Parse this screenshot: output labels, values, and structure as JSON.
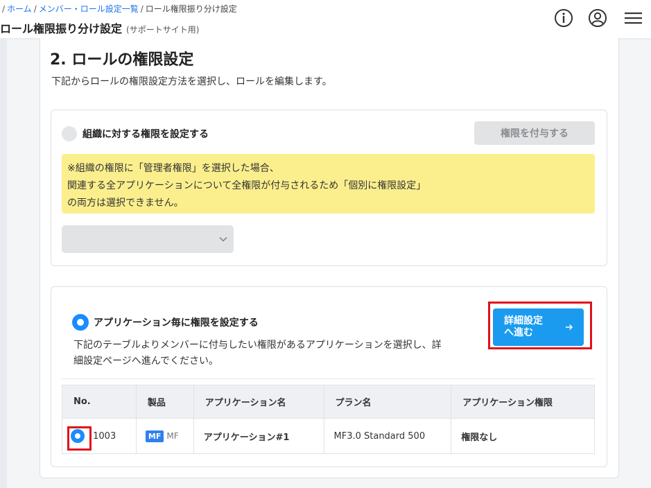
{
  "header": {
    "breadcrumb": {
      "lead_sep": "/",
      "home": "ホーム",
      "sep": "/",
      "members": "メンバー・ロール設定一覧",
      "current": "ロール権限振り分け設定"
    },
    "title": "ロール権限振り分け設定",
    "subtitle": "(サポートサイト用)",
    "icons": [
      "info-icon",
      "user-icon",
      "menu-icon"
    ]
  },
  "section": {
    "title": "2. ロールの権限設定",
    "description": "下記からロールの権限設定方法を選択し、ロールを編集します。"
  },
  "org_option": {
    "label": "組織に対する権限を設定する",
    "selected": false,
    "grant_button": "権限を付与する",
    "note_lines": [
      "※組織の権限に「管理者権限」を選択した場合、",
      "関連する全アプリケーションについて全権限が付与されるため「個別に権限設定」",
      "の両方は選択できません。"
    ],
    "select_value": ""
  },
  "app_option": {
    "label": "アプリケーション毎に権限を設定する",
    "selected": true,
    "description_lines": [
      "下記のテーブルよりメンバーに付与したい権限があるアプリケーションを選択し、詳",
      "細設定ページへ進んでください。"
    ],
    "detail_button_line1": "詳細設定",
    "detail_button_line2": "へ進む",
    "table": {
      "headers": [
        "No.",
        "製品",
        "アプリケーション名",
        "プラン名",
        "アプリケーション権限"
      ],
      "rows": [
        {
          "no": "1003",
          "product_badge": "MF",
          "product_name": "MF",
          "app_name": "アプリケーション#1",
          "plan": "MF3.0 Standard 500",
          "permission": "権限なし",
          "selected": true
        }
      ]
    }
  },
  "colors": {
    "accent": "#1a9bf0",
    "highlight": "#e0101a",
    "note_bg": "#fbef8d"
  }
}
